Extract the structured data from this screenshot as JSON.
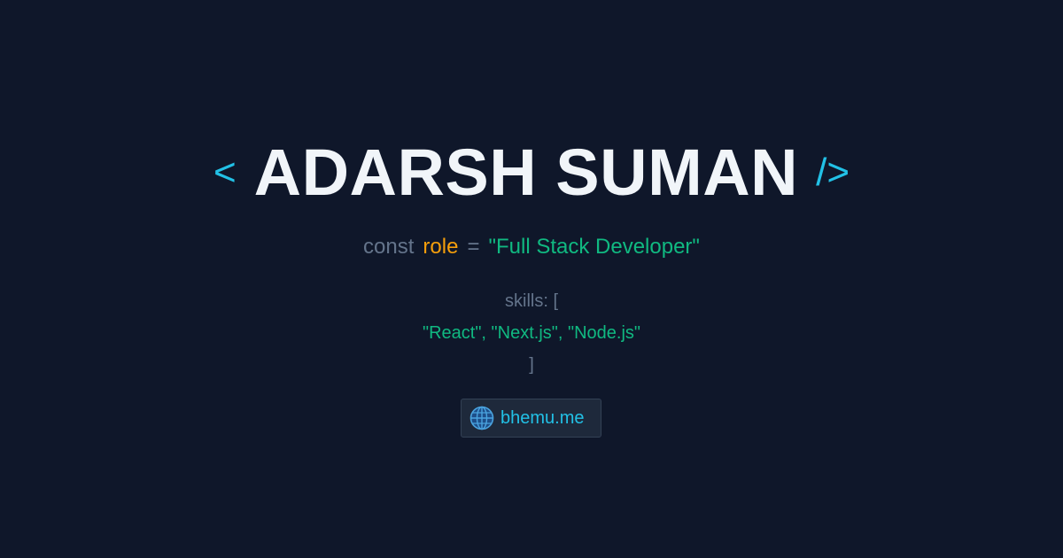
{
  "header": {
    "open_tag": "<",
    "name": "ADARSH SUMAN",
    "close_tag": "/>"
  },
  "role_line": {
    "keyword": "const",
    "variable": "role",
    "operator": "=",
    "value": "\"Full Stack Developer\""
  },
  "skills": {
    "open": "skills: [",
    "items": "\"React\", \"Next.js\", \"Node.js\"",
    "close": "]"
  },
  "link": {
    "icon": "globe-icon",
    "text": "bhemu.me"
  },
  "colors": {
    "background": "#0f172a",
    "accent_cyan": "#22c1e6",
    "name_white": "#f1f5f9",
    "keyword_gray": "#64748b",
    "variable_orange": "#f59e0b",
    "string_green": "#10b981",
    "badge_background": "#1e293b"
  }
}
